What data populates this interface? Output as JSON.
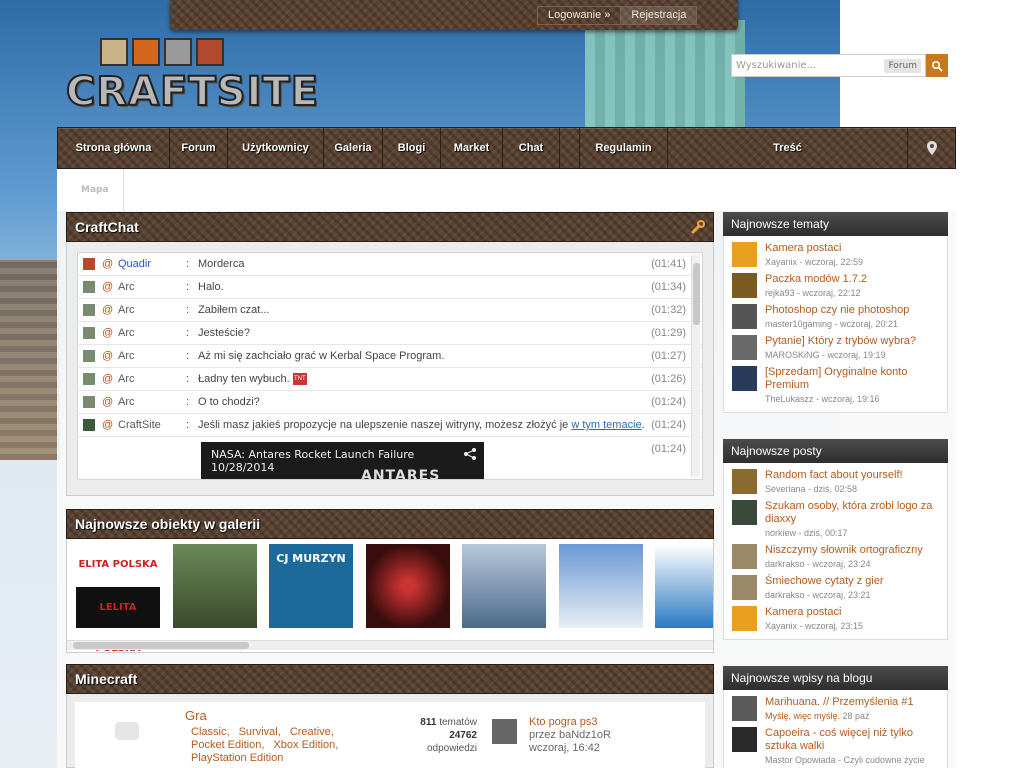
{
  "userbar": {
    "login": "Logowanie »",
    "register": "Rejestracja"
  },
  "logo": {
    "text": "CRAFTSITE"
  },
  "search": {
    "placeholder": "Wyszukiwanie...",
    "scope": "Forum"
  },
  "nav": {
    "items": [
      "Strona główna",
      "Forum",
      "Użytkownicy",
      "Galeria",
      "Blogi",
      "Market",
      "Chat",
      "Regulamin",
      "Treść"
    ],
    "sub": "Mapa"
  },
  "chat": {
    "title": "CraftChat",
    "messages": [
      {
        "user": "Quadir",
        "text": "Morderca",
        "time": "(01:41)"
      },
      {
        "user": "Arc",
        "text": "Halo.",
        "time": "(01:34)"
      },
      {
        "user": "Arc",
        "text": "Zabiłem czat...",
        "time": "(01:32)"
      },
      {
        "user": "Arc",
        "text": "Jesteście?",
        "time": "(01:29)"
      },
      {
        "user": "Arc",
        "text": "Aż mi się zachciało grać w Kerbal Space Program.",
        "time": "(01:27)"
      },
      {
        "user": "Arc",
        "text": "Ładny ten wybuch.",
        "time": "(01:26)"
      },
      {
        "user": "Arc",
        "text": "O to chodzi?",
        "time": "(01:24)"
      },
      {
        "user": "CraftSite",
        "text": "Jeśli masz jakieś propozycje na ulepszenie naszej witryny, możesz złożyć je",
        "link": "w tym temacie",
        "after": ".",
        "time": "(01:24)"
      },
      {
        "user": "",
        "text": "",
        "time": "(01:24)"
      }
    ],
    "at": "@",
    "colon": ":",
    "tnt": "TNT",
    "video_title": "NASA: Antares Rocket Launch Failure 10/28/2014",
    "video_big": "ANTARES"
  },
  "gallery": {
    "title": "Najnowsze obiekty w galerii",
    "thumbs": [
      {
        "label": "ELITA POLSKA",
        "color": "#ffffff"
      },
      {
        "label": "",
        "color": "#4a5a3a"
      },
      {
        "label": "CJ MURZYN",
        "color": "#1c6a9c"
      },
      {
        "label": "",
        "color": "#4a1a1a"
      },
      {
        "label": "",
        "color": "#4d6a8a"
      },
      {
        "label": "",
        "color": "#8aa6c6"
      },
      {
        "label": "",
        "color": "#dfe6ee"
      }
    ],
    "second_thumb": "LELITA POLSKA"
  },
  "minecraft": {
    "title": "Minecraft",
    "forum": "Gra",
    "subforums": [
      "Classic,",
      "Survival,",
      "Creative,",
      "Pocket Edition,",
      "Xbox Edition,",
      "PlayStation Edition"
    ],
    "topics_count": "811",
    "topics_label": "tematów",
    "replies_count": "24762",
    "replies_label": "odpowiedzi",
    "last_title": "Kto pogra ps3",
    "last_by": "przez baNdz1oR",
    "last_time": "wczoraj, 16:42"
  },
  "sidebar": {
    "topics": {
      "title": "Najnowsze tematy",
      "items": [
        {
          "title": "Kamera postaci",
          "meta": "Xayanix - wczoraj, 22:59",
          "color": "#e8a020"
        },
        {
          "title": "Paczka modów 1.7.2",
          "meta": "rejka93 - wczoraj, 22:12",
          "color": "#7a5a20"
        },
        {
          "title": "Photoshop czy nie photoshop",
          "meta": "master10gaming - wczoraj, 20:21",
          "color": "#555555"
        },
        {
          "title": "Pytanie] Który z trybów wybra?",
          "meta": "MAROSKiNG - wczoraj, 19:19",
          "color": "#6a6a6a"
        },
        {
          "title": "[Sprzedam] Oryginalne konto Premium",
          "meta": "TheLukaszz - wczoraj, 19:16",
          "color": "#2a3a5a"
        }
      ]
    },
    "posts": {
      "title": "Najnowsze posty",
      "items": [
        {
          "title": "Random fact about yourself!",
          "meta": "Severiana - dziś, 02:58",
          "color": "#8a6a30"
        },
        {
          "title": "Szukam osoby, która zrobi logo za diaxxy",
          "meta": "norkiew - dziś, 00:17",
          "color": "#3a4a3a"
        },
        {
          "title": "Niszczymy słownik ortograficzny",
          "meta": "darkrakso - wczoraj, 23:24",
          "color": "#9a8a6a"
        },
        {
          "title": "Śmiechowe cytaty z gier",
          "meta": "darkrakso - wczoraj, 23:21",
          "color": "#9a8a6a"
        },
        {
          "title": "Kamera postaci",
          "meta": "Xayanix - wczoraj, 23:15",
          "color": "#e8a020"
        }
      ]
    },
    "blog": {
      "title": "Najnowsze wpisy na blogu",
      "items": [
        {
          "title": "Marihuana. // Przemyślenia #1",
          "meta": "Myślę, więc myślę.",
          "meta2": "28 paź",
          "color": "#5a5a5a"
        },
        {
          "title": "Capoeira - coś więcej niż tylko sztuka walki",
          "meta": "Mastor Opowiada",
          "meta2": "Czyli cudowne życie",
          "color": "#2a2a2a"
        }
      ]
    }
  }
}
